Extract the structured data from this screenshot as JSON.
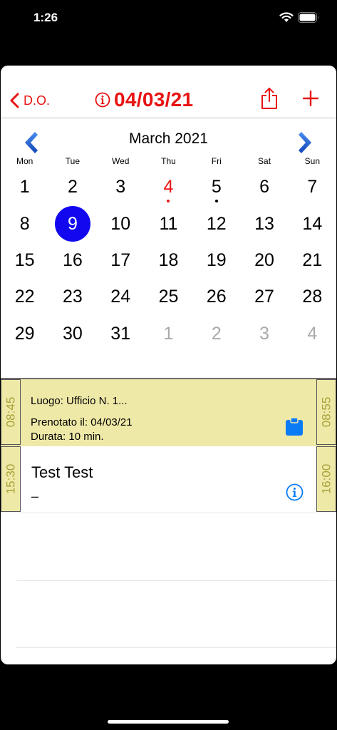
{
  "status_bar": {
    "time": "1:26"
  },
  "nav": {
    "back_label": "D.O.",
    "title": "04/03/21",
    "accent_color": "#e81313"
  },
  "calendar": {
    "month_title": "March 2021",
    "weekdays": [
      "Mon",
      "Tue",
      "Wed",
      "Thu",
      "Fri",
      "Sat",
      "Sun"
    ],
    "weeks": [
      [
        "1",
        "2",
        "3",
        "4",
        "5",
        "6",
        "7"
      ],
      [
        "8",
        "9",
        "10",
        "11",
        "12",
        "13",
        "14"
      ],
      [
        "15",
        "16",
        "17",
        "18",
        "19",
        "20",
        "21"
      ],
      [
        "22",
        "23",
        "24",
        "25",
        "26",
        "27",
        "28"
      ],
      [
        "29",
        "30",
        "31",
        "1",
        "2",
        "3",
        "4"
      ]
    ],
    "selected_day": "9",
    "highlighted_day": "4",
    "days_with_events": [
      "4",
      "5"
    ],
    "selected_color": "#1208f0"
  },
  "appointments": [
    {
      "start": "08:45",
      "end": "08:55",
      "line1": "Luogo: Ufficio N. 1...",
      "line2": "Prenotato il: 04/03/21",
      "line3": "Durata: 10 min.",
      "icon": "clipboard-icon"
    },
    {
      "start": "15:30",
      "end": "16:00",
      "name": "Test Test",
      "subtitle": "–",
      "icon": "info-icon"
    }
  ]
}
